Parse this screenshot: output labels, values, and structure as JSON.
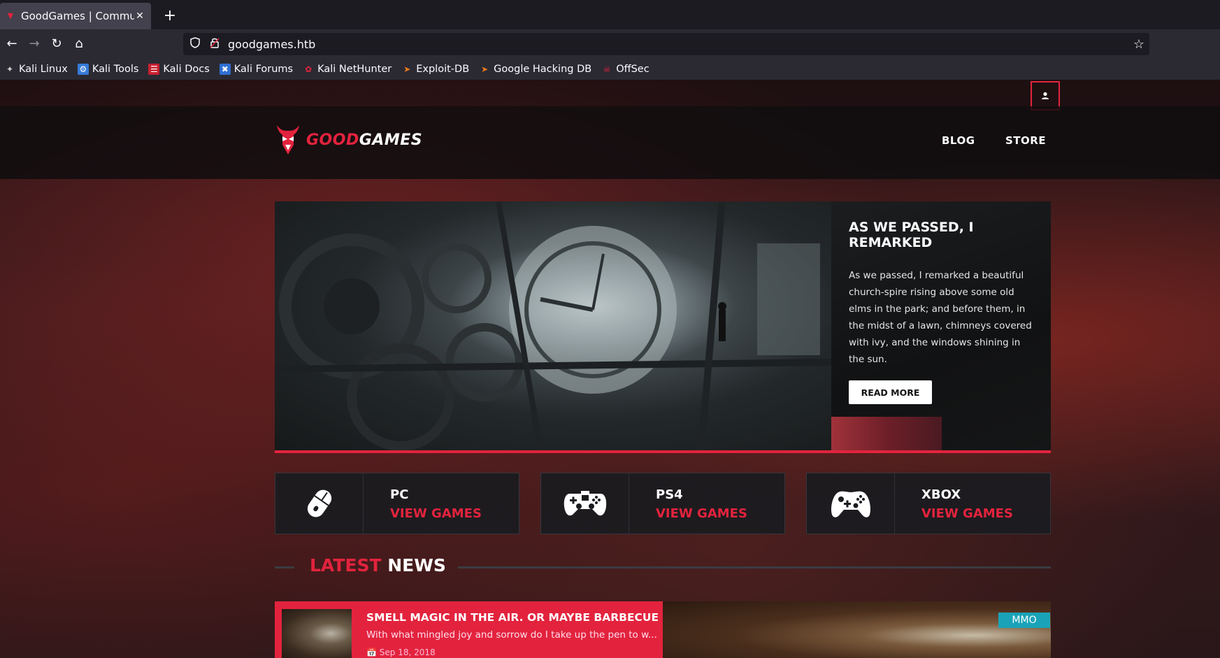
{
  "browser": {
    "tab_title": "GoodGames | Community and Store",
    "url": "goodgames.htb",
    "bookmarks": [
      "Kali Linux",
      "Kali Tools",
      "Kali Docs",
      "Kali Forums",
      "Kali NetHunter",
      "Exploit-DB",
      "Google Hacking DB",
      "OffSec"
    ]
  },
  "site": {
    "logo_part1": "GOOD",
    "logo_part2": "GAMES",
    "menu": [
      "BLOG",
      "STORE"
    ]
  },
  "hero": {
    "title": "AS WE PASSED, I REMARKED",
    "text": "As we passed, I remarked a beautiful church-spire rising above some old elms in the park; and before them, in the midst of a lawn, chimneys covered with ivy, and the windows shining in the sun.",
    "button": "READ MORE"
  },
  "categories": [
    {
      "name": "PC",
      "link": "VIEW GAMES",
      "icon": "mouse-icon"
    },
    {
      "name": "PS4",
      "link": "VIEW GAMES",
      "icon": "ps4-gamepad-icon"
    },
    {
      "name": "XBOX",
      "link": "VIEW GAMES",
      "icon": "xbox-gamepad-icon"
    }
  ],
  "news_section": {
    "title_part1": "LATEST",
    "title_part2": "NEWS"
  },
  "news": [
    {
      "title": "SMELL MAGIC IN THE AIR. OR MAYBE BARBECUE",
      "excerpt": "With what mingled joy and sorrow do I take up the pen to w...",
      "date": "Sep 18, 2018",
      "badge": "MMO"
    }
  ],
  "colors": {
    "accent": "#e3233d",
    "badge": "#1aa3b8"
  }
}
